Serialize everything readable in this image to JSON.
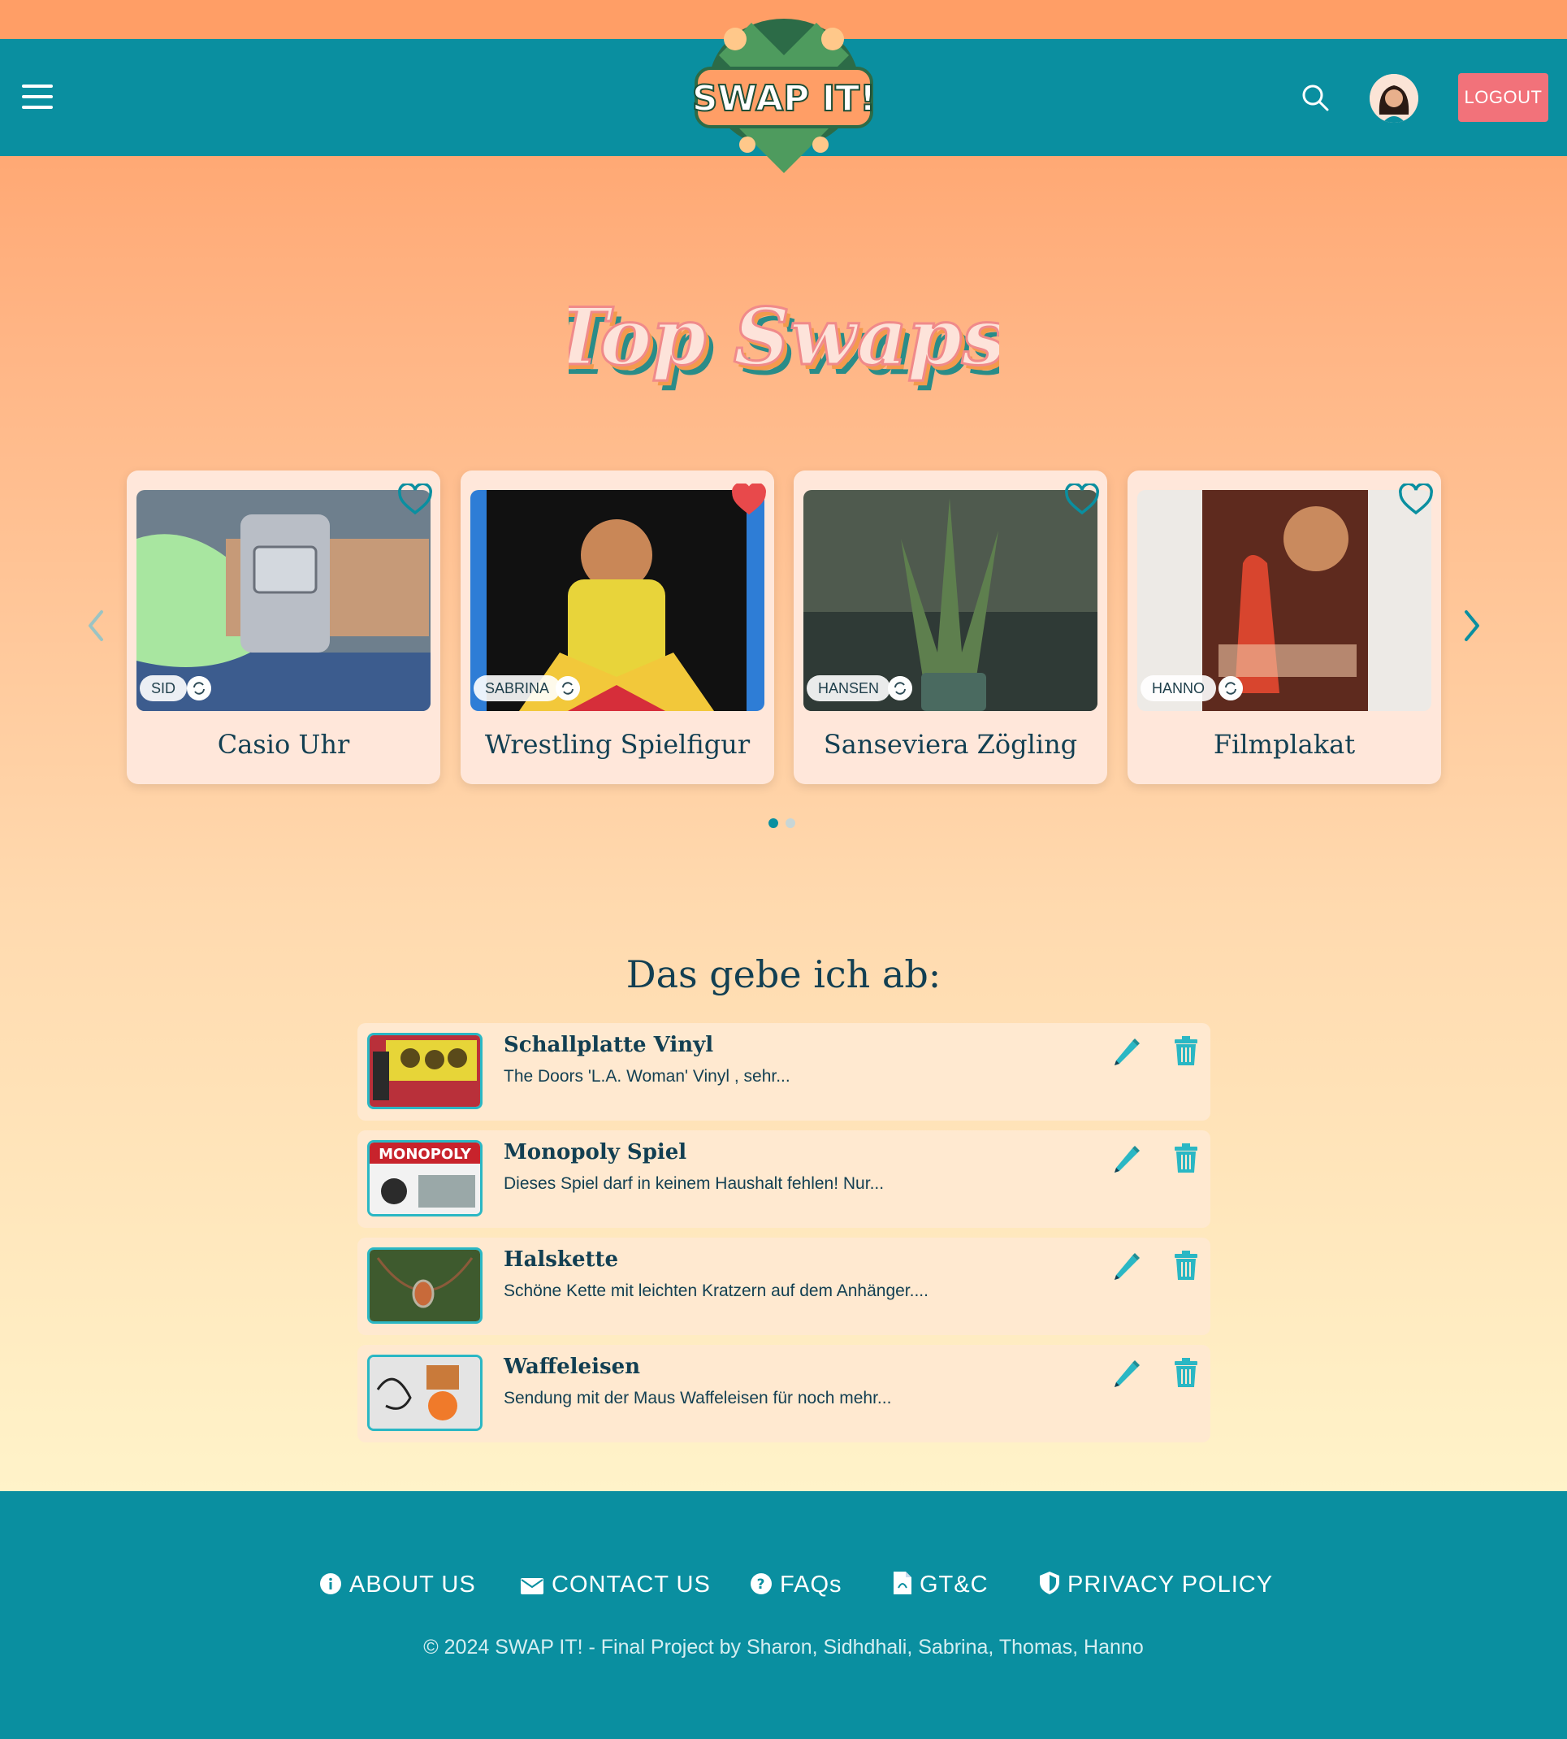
{
  "header": {
    "logo_text": "SWAP IT!",
    "logout_label": "LOGOUT"
  },
  "hero": {
    "title": "Top Swaps"
  },
  "carousel": {
    "cards": [
      {
        "title": "Casio Uhr",
        "owner": "SID",
        "favorited": false
      },
      {
        "title": "Wrestling Spielfigur",
        "owner": "SABRINA",
        "favorited": true
      },
      {
        "title": "Sanseviera Zögling",
        "owner": "HANSEN",
        "favorited": false
      },
      {
        "title": "Filmplakat",
        "owner": "HANNO",
        "favorited": false
      }
    ],
    "active_page": 1,
    "page_count": 2
  },
  "giveaway": {
    "title": "Das gebe ich ab:",
    "items": [
      {
        "name": "Schallplatte Vinyl",
        "desc": "The Doors 'L.A. Woman' Vinyl , sehr..."
      },
      {
        "name": "Monopoly Spiel",
        "desc": "Dieses Spiel darf in keinem Haushalt fehlen! Nur..."
      },
      {
        "name": "Halskette",
        "desc": "Schöne Kette mit leichten Kratzern auf dem Anhänger...."
      },
      {
        "name": "Waffeleisen",
        "desc": "Sendung mit der Maus Waffeleisen für noch mehr..."
      }
    ]
  },
  "footer": {
    "links": [
      "ABOUT US",
      "CONTACT US",
      "FAQs",
      "GT&C",
      "PRIVACY POLICY"
    ],
    "copyright": "© 2024 SWAP IT! - Final Project by Sharon, Sidhdhali, Sabrina, Thomas, Hanno"
  },
  "colors": {
    "teal": "#0A8FA0",
    "orange": "#FF9E66",
    "logout": "#F2727A",
    "heart_active": "#E8494B",
    "icon_teal": "#2AB7C4"
  }
}
